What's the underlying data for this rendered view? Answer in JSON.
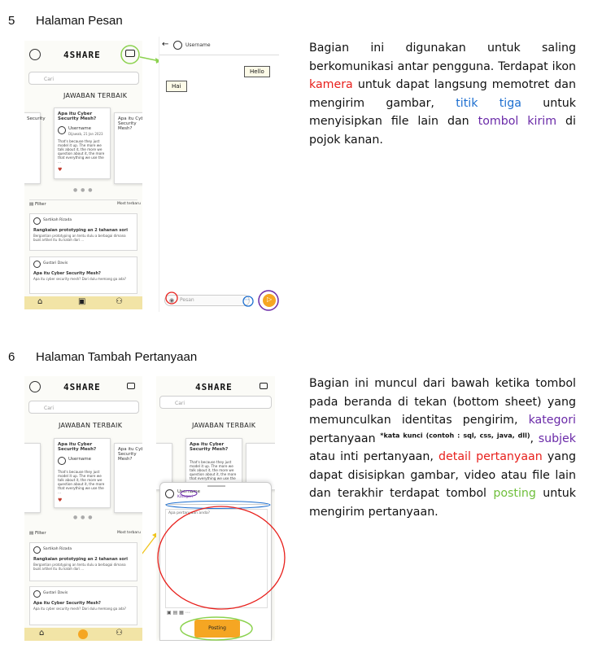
{
  "section5": {
    "number": "5",
    "title": "Halaman Pesan",
    "para_a": "Bagian ini digunakan untuk saling berkomunikasi antar pengguna. Terdapat ikon ",
    "kamera": "kamera",
    "para_b": " untuk dapat langsung memotret dan mengirim gambar, ",
    "titik_tiga": "titik tiga",
    "para_c": " untuk menyisipkan file lain dan ",
    "tombol_kirim": "tombol kirim",
    "para_d": " di pojok kanan."
  },
  "section6": {
    "number": "6",
    "title": "Halaman Tambah Pertanyaan",
    "para_a": "Bagian ini muncul dari bawah ketika tombol pada beranda di tekan (bottom sheet) yang memunculkan identitas pengirim, ",
    "kategori": "kategori",
    "para_b": " pertanyaan ",
    "kata_kunci": "*kata kunci (contoh : sql, css, java, dll)",
    "para_c": ", ",
    "subjek": "subjek",
    "para_d": " atau inti pertanyaan, ",
    "detail": "detail pertanyaan",
    "para_e": " yang dapat disisipkan gambar, video atau file lain dan terakhir terdapat tombol ",
    "posting": "posting",
    "para_f": " untuk mengirim pertanyaan."
  },
  "mock": {
    "brand": "4SHARE",
    "search_placeholder": "Cari",
    "section_heading": "JAWABAN TERBAIK",
    "card_question": "Apa itu Cyber Security Mesh?",
    "card_user": "Username",
    "card_date": "Dijawab, 21 Jan 2023",
    "card_answer": "That's because they just model it up. The more we talk about it, the more we question about it, the more that everything we use the ...",
    "left_card_title": "Security",
    "right_card_title": "Apa itu Cyber Security Mesh?",
    "filter_label": "Filter",
    "filter_right": "Most terbaru",
    "feed1_user": "Sartikah Rizada",
    "feed1_time": "2hr ago",
    "feed1_title": "Rangkaian prototyping an 2 tahanan sori",
    "feed1_body": "Bergantian prototyping an tentu dulu a berbagai dimana buat artikel itu itu kalah dari ...",
    "feed2_user": "Gustari Davis",
    "feed2_time": "1 hr ago",
    "feed2_title": "Apa itu Cyber Security Mesh?",
    "feed2_body": "Apa itu cyber security mesh? Dari dulu memang ga ada?",
    "chat_username": "Username",
    "msg_out": "Hello",
    "msg_in": "Hai",
    "pesan_placeholder": "Pesan",
    "sheet_user": "Username",
    "sheet_category": "Kategori",
    "sheet_placeholder": "Apa pertanyaan anda?",
    "posting_button": "Posting"
  },
  "colors": {
    "nav_bar": "#f2e4a6",
    "send_button": "#f5a623",
    "annotation_red": "#e8201c",
    "annotation_green": "#8cd24f",
    "annotation_purple": "#6a2aa8",
    "arrow_yellow": "#f0c419"
  }
}
